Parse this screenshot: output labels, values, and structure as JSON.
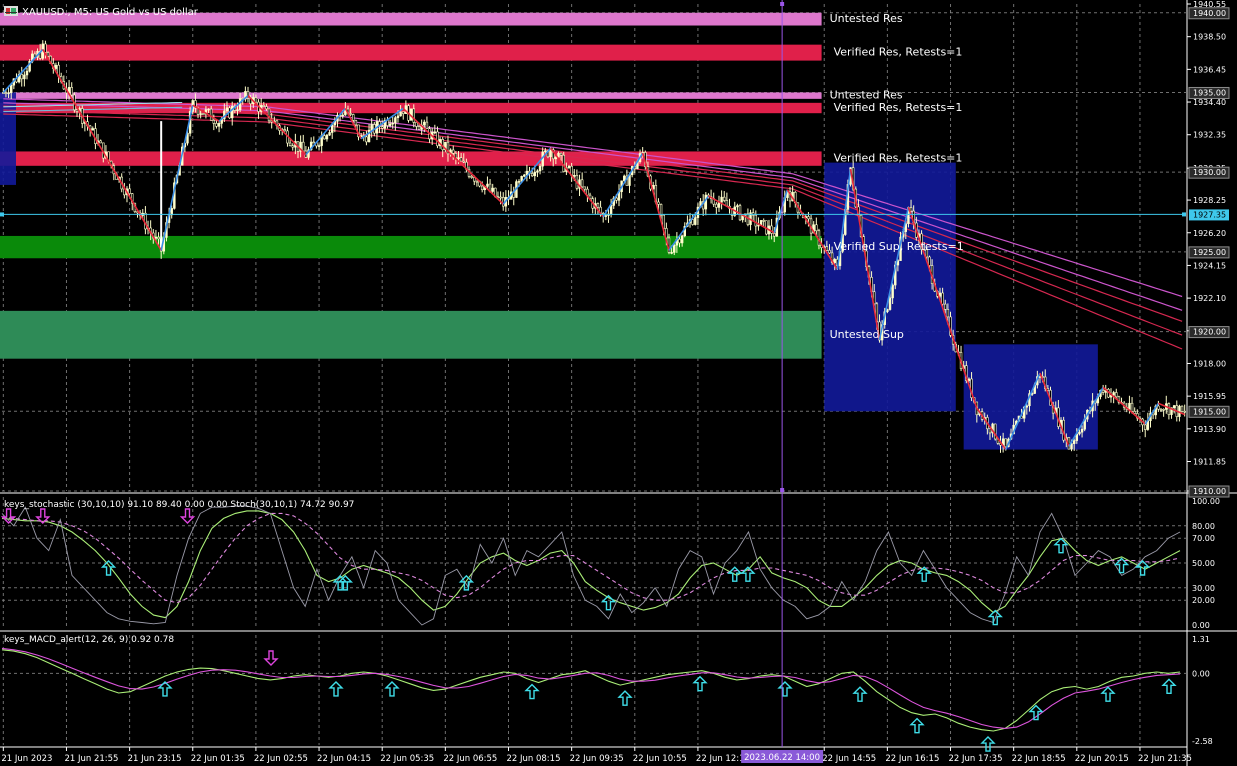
{
  "header": {
    "symbol_label": "XAUUSD., M5: US Gold vs US dollar",
    "stoch_label": "keys_stochastic (30,10,10) 91.10 89.40 0.00 0.00 Stoch(30,10,1) 74.72 90.97",
    "macd_label": "keys_MACD_alert(12, 26, 9) 0.92 0.78"
  },
  "colors": {
    "background": "#000000",
    "grid": "#8c8c8c",
    "candle": "#ffffcc",
    "zigzag_down": "#e8293a",
    "zigzag_up": "#3a8ee6",
    "ma_band": "#d62850",
    "ma_band_magenta": "#cc55cc",
    "zone_untested_res": "#dd77cc",
    "zone_verified_res": "#e0204a",
    "zone_verified_sup": "#0a8a0a",
    "zone_untested_sup": "#2e8b57",
    "box_blue": "#121a9a",
    "crosshair_h": "#3ec8ec",
    "crosshair_v": "#9a55e8",
    "stoch_main": "#aaee77",
    "stoch_signal": "#dd88dd",
    "stoch_fast": "#9a9aa8",
    "macd_main": "#aaee77",
    "macd_signal": "#dd55dd",
    "arrow_up": "#3fdde8",
    "arrow_down": "#dd44dd"
  },
  "price_axis": {
    "ticks": [
      "1940.55",
      "1938.50",
      "1936.45",
      "1934.40",
      "1932.35",
      "1930.25",
      "1928.25",
      "1926.20",
      "1924.15",
      "1922.10",
      "1920.05",
      "1918.00",
      "1915.95",
      "1913.90",
      "1911.85",
      "1910.00"
    ],
    "tick_values": [
      1940.55,
      1938.5,
      1936.45,
      1934.4,
      1932.35,
      1930.25,
      1928.25,
      1926.2,
      1924.15,
      1922.1,
      1920.05,
      1918.0,
      1915.95,
      1913.9,
      1911.85,
      1910.0
    ],
    "boxed_labels": [
      {
        "text": "1940.00",
        "value": 1940.0
      },
      {
        "text": "1935.00",
        "value": 1935.0
      },
      {
        "text": "1930.00",
        "value": 1930.0
      },
      {
        "text": "1925.00",
        "value": 1925.0
      },
      {
        "text": "1920.00",
        "value": 1920.0
      },
      {
        "text": "1915.00",
        "value": 1915.0
      },
      {
        "text": "1910.00",
        "value": 1910.0
      }
    ],
    "current_price": {
      "text": "1927.35",
      "value": 1927.35
    }
  },
  "time_axis": {
    "labels": [
      "21 Jun 2023",
      "21 Jun 21:55",
      "21 Jun 23:15",
      "22 Jun 01:35",
      "22 Jun 02:55",
      "22 Jun 04:15",
      "22 Jun 05:35",
      "22 Jun 06:55",
      "22 Jun 08:15",
      "22 Jun 09:35",
      "22 Jun 10:55",
      "22 Jun 12:15",
      "22 Jun 14:55",
      "22 Jun 16:15",
      "22 Jun 17:35",
      "22 Jun 18:55",
      "22 Jun 20:15",
      "22 Jun 21:35"
    ],
    "label_bar_index": [
      0,
      24,
      48,
      72,
      96,
      120,
      144,
      168,
      192,
      216,
      240,
      264,
      312,
      336,
      360,
      384,
      408,
      432
    ],
    "cursor_time": "2023.06.22 14:00",
    "cursor_bar_index": 296
  },
  "zones": [
    {
      "label": "Untested Res",
      "kind": "untested_res",
      "top": 1940.0,
      "bottom": 1939.2,
      "end_bar": 311
    },
    {
      "label": "Verified Res, Retests=1",
      "kind": "verified_res",
      "top": 1938.0,
      "bottom": 1937.0,
      "end_bar": 311
    },
    {
      "label": "Untested Res",
      "kind": "untested_res",
      "top": 1935.0,
      "bottom": 1934.6,
      "end_bar": 311
    },
    {
      "label": "Verified Res, Retests=1",
      "kind": "verified_res",
      "top": 1934.35,
      "bottom": 1933.7,
      "end_bar": 311
    },
    {
      "label": "Verified Res, Retests=1",
      "kind": "verified_res",
      "top": 1931.3,
      "bottom": 1930.4,
      "end_bar": 311
    },
    {
      "label": "Verified Sup, Retests=1",
      "kind": "verified_sup",
      "top": 1926.0,
      "bottom": 1924.6,
      "end_bar": 311
    },
    {
      "label": "Untested Sup",
      "kind": "untested_sup",
      "top": 1921.3,
      "bottom": 1918.3,
      "end_bar": 311
    }
  ],
  "chart_data": [
    {
      "type": "candlestick",
      "title": "XAUUSD., M5: US Gold vs US dollar",
      "ylim": [
        1910.0,
        1940.55
      ],
      "bars": 450,
      "zigzag": [
        {
          "bar": 0,
          "price": 1935.0
        },
        {
          "bar": 15,
          "price": 1937.7
        },
        {
          "bar": 60,
          "price": 1925.1
        },
        {
          "bar": 72,
          "price": 1934.2
        },
        {
          "bar": 82,
          "price": 1933.2
        },
        {
          "bar": 93,
          "price": 1934.8
        },
        {
          "bar": 115,
          "price": 1931.1
        },
        {
          "bar": 130,
          "price": 1934.0
        },
        {
          "bar": 136,
          "price": 1932.1
        },
        {
          "bar": 152,
          "price": 1934.0
        },
        {
          "bar": 190,
          "price": 1928.0
        },
        {
          "bar": 208,
          "price": 1931.5
        },
        {
          "bar": 228,
          "price": 1927.2
        },
        {
          "bar": 243,
          "price": 1931.2
        },
        {
          "bar": 253,
          "price": 1925.1
        },
        {
          "bar": 268,
          "price": 1928.5
        },
        {
          "bar": 293,
          "price": 1926.2
        },
        {
          "bar": 298,
          "price": 1928.9
        },
        {
          "bar": 317,
          "price": 1923.9
        },
        {
          "bar": 322,
          "price": 1930.2
        },
        {
          "bar": 333,
          "price": 1919.5
        },
        {
          "bar": 344,
          "price": 1927.8
        },
        {
          "bar": 370,
          "price": 1915.2
        },
        {
          "bar": 381,
          "price": 1912.6
        },
        {
          "bar": 394,
          "price": 1917.4
        },
        {
          "bar": 405,
          "price": 1912.8
        },
        {
          "bar": 418,
          "price": 1916.5
        },
        {
          "bar": 434,
          "price": 1914.2
        },
        {
          "bar": 439,
          "price": 1915.5
        },
        {
          "bar": 449,
          "price": 1914.8
        }
      ],
      "boxes": [
        {
          "from_bar": 312,
          "to_bar": 362,
          "top": 1930.6,
          "bottom": 1915.0
        },
        {
          "from_bar": 365,
          "to_bar": 416,
          "top": 1919.2,
          "bottom": 1912.6
        }
      ]
    },
    {
      "type": "line",
      "title": "keys_stochastic (30,10,10) 91.10 89.40 0.00 0.00 Stoch(30,10,1) 74.72 90.97",
      "ylim": [
        0,
        100
      ],
      "levels": [
        0,
        20,
        30,
        50,
        70,
        80,
        100
      ],
      "level_labels": [
        "0.00",
        "20.00",
        "30.00",
        "50.00",
        "70.00",
        "80.00",
        "100.00"
      ],
      "series": [
        {
          "values": [
            86,
            85,
            84,
            84,
            83,
            80,
            75,
            68,
            60,
            50,
            38,
            25,
            15,
            8,
            6,
            15,
            35,
            60,
            78,
            86,
            90,
            92,
            92,
            90,
            85,
            75,
            60,
            40,
            35,
            38,
            45,
            48,
            45,
            42,
            38,
            30,
            20,
            12,
            15,
            25,
            38,
            50,
            55,
            58,
            52,
            48,
            52,
            58,
            60,
            50,
            35,
            28,
            22,
            18,
            15,
            12,
            14,
            18,
            25,
            38,
            48,
            50,
            45,
            40,
            45,
            55,
            42,
            38,
            35,
            30,
            20,
            15,
            15,
            22,
            30,
            40,
            48,
            52,
            50,
            45,
            42,
            40,
            35,
            28,
            18,
            10,
            15,
            28,
            40,
            55,
            68,
            70,
            60,
            52,
            48,
            52,
            55,
            50,
            45,
            50,
            55,
            60
          ]
        },
        {
          "values": [
            87,
            86,
            85,
            84,
            84,
            83,
            80,
            76,
            70,
            62,
            54,
            45,
            36,
            28,
            20,
            18,
            22,
            32,
            45,
            58,
            70,
            80,
            86,
            90,
            90,
            88,
            82,
            74,
            64,
            54,
            48,
            45,
            45,
            44,
            42,
            40,
            36,
            30,
            24,
            22,
            24,
            30,
            38,
            45,
            50,
            52,
            52,
            54,
            56,
            56,
            50,
            44,
            38,
            32,
            26,
            22,
            20,
            20,
            22,
            26,
            32,
            38,
            42,
            44,
            44,
            46,
            46,
            44,
            42,
            40,
            36,
            30,
            26,
            24,
            24,
            28,
            34,
            40,
            44,
            46,
            46,
            45,
            43,
            40,
            36,
            30,
            26,
            26,
            30,
            36,
            44,
            52,
            56,
            56,
            54,
            52,
            52,
            52,
            51,
            51,
            52,
            54
          ]
        },
        {
          "values": [
            90,
            80,
            95,
            70,
            60,
            85,
            40,
            30,
            20,
            10,
            5,
            3,
            2,
            1,
            2,
            40,
            70,
            90,
            95,
            95,
            96,
            96,
            94,
            90,
            60,
            30,
            15,
            45,
            20,
            40,
            55,
            30,
            60,
            50,
            20,
            10,
            0,
            5,
            40,
            45,
            30,
            65,
            50,
            70,
            40,
            60,
            55,
            65,
            75,
            40,
            20,
            15,
            5,
            25,
            10,
            18,
            30,
            15,
            45,
            60,
            55,
            25,
            50,
            60,
            75,
            45,
            30,
            20,
            15,
            5,
            8,
            15,
            35,
            20,
            35,
            60,
            75,
            50,
            40,
            60,
            45,
            30,
            20,
            10,
            5,
            2,
            25,
            55,
            40,
            75,
            90,
            70,
            40,
            50,
            60,
            55,
            40,
            45,
            55,
            60,
            70,
            75
          ]
        }
      ],
      "arrows_up_bars": [
        40,
        128,
        130,
        176,
        230,
        278,
        283,
        350,
        377,
        402,
        425,
        433
      ],
      "arrows_down_bars": [
        2,
        15,
        70
      ]
    },
    {
      "type": "line",
      "title": "keys_MACD_alert(12, 26, 9) 0.92 0.78",
      "ylim": [
        -2.58,
        1.31
      ],
      "level_labels": [
        "1.31",
        "0.00",
        "-2.58"
      ],
      "level_values": [
        1.31,
        0.0,
        -2.58
      ],
      "series": [
        {
          "values": [
            0.9,
            0.85,
            0.75,
            0.6,
            0.4,
            0.2,
            0.0,
            -0.2,
            -0.4,
            -0.6,
            -0.75,
            -0.7,
            -0.5,
            -0.3,
            -0.1,
            0.05,
            0.15,
            0.2,
            0.18,
            0.1,
            0.0,
            -0.1,
            -0.2,
            -0.25,
            -0.2,
            -0.1,
            -0.05,
            -0.1,
            -0.15,
            -0.1,
            0.0,
            0.05,
            0.0,
            -0.1,
            -0.25,
            -0.4,
            -0.55,
            -0.65,
            -0.6,
            -0.45,
            -0.3,
            -0.15,
            -0.05,
            0.05,
            0.0,
            -0.2,
            -0.35,
            -0.2,
            -0.05,
            0.0,
            0.1,
            -0.1,
            -0.3,
            -0.45,
            -0.35,
            -0.25,
            -0.15,
            -0.05,
            0.0,
            0.05,
            0.1,
            0.0,
            -0.15,
            -0.25,
            -0.2,
            -0.1,
            -0.05,
            -0.1,
            -0.3,
            -0.5,
            -0.4,
            -0.2,
            0.0,
            0.05,
            -0.3,
            -0.7,
            -1.0,
            -1.3,
            -1.5,
            -1.6,
            -1.55,
            -1.7,
            -1.9,
            -2.05,
            -2.15,
            -2.2,
            -2.1,
            -1.8,
            -1.4,
            -1.0,
            -0.7,
            -0.55,
            -0.5,
            -0.6,
            -0.5,
            -0.3,
            -0.15,
            -0.1,
            0.0,
            0.05,
            0.0,
            0.05
          ]
        },
        {
          "values": [
            0.95,
            0.9,
            0.82,
            0.7,
            0.55,
            0.38,
            0.2,
            0.02,
            -0.15,
            -0.32,
            -0.48,
            -0.58,
            -0.6,
            -0.52,
            -0.38,
            -0.22,
            -0.08,
            0.05,
            0.12,
            0.14,
            0.12,
            0.06,
            -0.02,
            -0.1,
            -0.16,
            -0.16,
            -0.12,
            -0.1,
            -0.12,
            -0.12,
            -0.08,
            -0.02,
            0.0,
            -0.04,
            -0.12,
            -0.22,
            -0.34,
            -0.46,
            -0.55,
            -0.56,
            -0.5,
            -0.38,
            -0.25,
            -0.12,
            -0.04,
            -0.08,
            -0.18,
            -0.22,
            -0.16,
            -0.08,
            0.0,
            0.02,
            -0.08,
            -0.22,
            -0.3,
            -0.3,
            -0.26,
            -0.18,
            -0.1,
            -0.04,
            0.02,
            0.02,
            -0.05,
            -0.14,
            -0.18,
            -0.16,
            -0.12,
            -0.1,
            -0.16,
            -0.28,
            -0.36,
            -0.32,
            -0.2,
            -0.08,
            -0.12,
            -0.3,
            -0.55,
            -0.82,
            -1.08,
            -1.3,
            -1.42,
            -1.52,
            -1.65,
            -1.8,
            -1.95,
            -2.05,
            -2.1,
            -2.05,
            -1.85,
            -1.55,
            -1.22,
            -0.95,
            -0.75,
            -0.68,
            -0.6,
            -0.48,
            -0.35,
            -0.24,
            -0.15,
            -0.08,
            -0.05,
            -0.02
          ]
        }
      ],
      "arrows_up_bars": [
        40,
        152,
        180,
        256,
        298,
        338,
        354,
        394,
        442,
        462,
        482,
        530
      ],
      "arrows_down_bars": [
        116
      ]
    }
  ]
}
